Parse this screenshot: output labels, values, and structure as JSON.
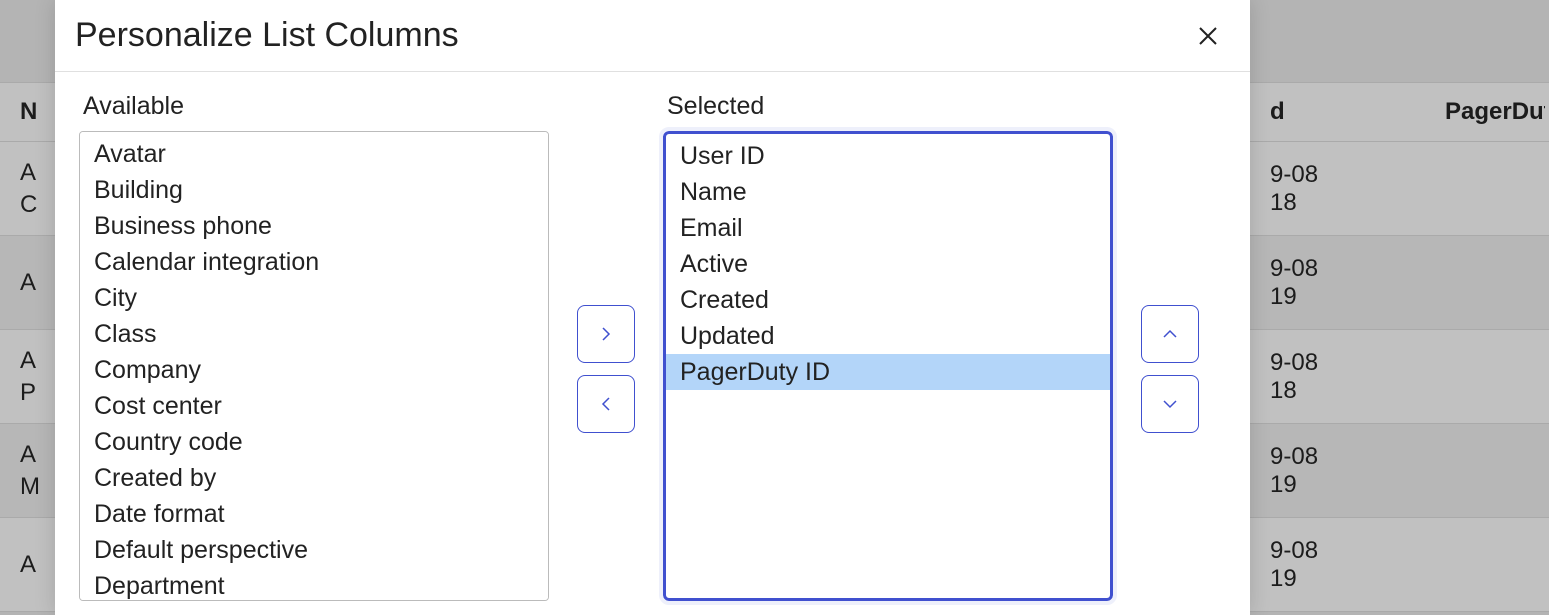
{
  "modal": {
    "title": "Personalize List Columns",
    "available_label": "Available",
    "selected_label": "Selected",
    "available": [
      "Avatar",
      "Building",
      "Business phone",
      "Calendar integration",
      "City",
      "Class",
      "Company",
      "Cost center",
      "Country code",
      "Created by",
      "Date format",
      "Default perspective",
      "Department"
    ],
    "selected": [
      "User ID",
      "Name",
      "Email",
      "Active",
      "Created",
      "Updated",
      "PagerDuty ID"
    ],
    "selected_highlight_index": 6
  },
  "background": {
    "header": {
      "col0": "N",
      "col1": "d",
      "col2": "PagerDut"
    },
    "rows": [
      {
        "name_l1": "A",
        "name_l2": "C",
        "d1": "9-08",
        "d2": "18"
      },
      {
        "name_l1": "A",
        "name_l2": "",
        "d1": "9-08",
        "d2": "19"
      },
      {
        "name_l1": "A",
        "name_l2": "P",
        "d1": "9-08",
        "d2": "18"
      },
      {
        "name_l1": "A",
        "name_l2": "M",
        "d1": "9-08",
        "d2": "19"
      },
      {
        "name_l1": "A",
        "name_l2": "",
        "d1": "9-08",
        "d2": "19"
      }
    ]
  }
}
